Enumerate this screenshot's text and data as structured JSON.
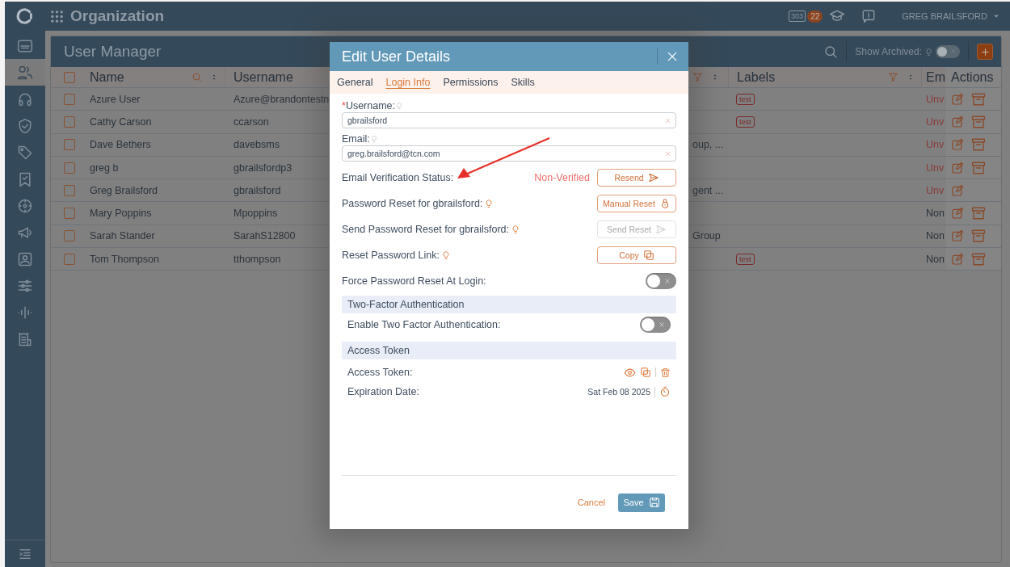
{
  "topbar": {
    "title": "Organization",
    "chat_count": "303",
    "badge": "22",
    "user": "GREG BRAILSFORD"
  },
  "sidebar": {
    "items": [
      {
        "selected": false
      },
      {
        "selected": true
      },
      {
        "selected": false
      },
      {
        "selected": false
      },
      {
        "selected": false
      },
      {
        "selected": false
      },
      {
        "selected": false
      },
      {
        "selected": false
      },
      {
        "selected": false
      },
      {
        "selected": false
      },
      {
        "selected": false
      },
      {
        "selected": false
      }
    ]
  },
  "panel": {
    "title": "User Manager",
    "show_archived": {
      "label": "Show Archived:",
      "on": false
    }
  },
  "table": {
    "select_all": {
      "checked": false
    },
    "columns": [
      {
        "label": "Name"
      },
      {
        "label": "Username"
      },
      {
        "label": "Labels"
      },
      {
        "label": "Em"
      },
      {
        "label": "Actions"
      }
    ],
    "rows": [
      {
        "checked": false,
        "name": "Azure User",
        "username": "Azure@brandontestn",
        "label_tag": "test",
        "email_status": "Unv",
        "color": "#8a3a3a",
        "archivable": true
      },
      {
        "checked": false,
        "name": "Cathy Carson",
        "username": "ccarson",
        "label_tag": "test",
        "email_status": "Unv",
        "color": "#8a3a3a",
        "archivable": true
      },
      {
        "checked": false,
        "name": "Dave Bethers",
        "username": "davebsms",
        "column_4": "oup, ...",
        "email_status": "Unv",
        "color": "#8a3a3a",
        "archivable": true
      },
      {
        "checked": false,
        "name": "greg b",
        "username": "gbrailsfordp3",
        "email_status": "Unv",
        "color": "#8a3a3a",
        "archivable": true
      },
      {
        "checked": false,
        "name": "Greg Brailsford",
        "username": "gbrailsford",
        "column_4": "gent ...",
        "email_status": "Unv",
        "color": "#8a3a3a",
        "archivable": false
      },
      {
        "checked": false,
        "name": "Mary Poppins",
        "username": "Mpoppins",
        "email_status": "Non",
        "color": "#2a323a",
        "archivable": true
      },
      {
        "checked": false,
        "name": "Sarah Stander",
        "username": "SarahS12800",
        "column_4": "Group",
        "email_status": "Non",
        "color": "#2a323a",
        "archivable": true
      },
      {
        "checked": false,
        "name": "Tom Thompson",
        "username": "tthompson",
        "label_tag": "test",
        "email_status": "Non",
        "color": "#2a323a",
        "archivable": true
      }
    ]
  },
  "dialog": {
    "title": "Edit User Details",
    "tabs": [
      {
        "label": "General",
        "selected": false
      },
      {
        "label": "Login Info",
        "selected": true
      },
      {
        "label": "Permissions",
        "selected": false
      },
      {
        "label": "Skills",
        "selected": false
      }
    ],
    "fields": [
      {
        "required_mark": "*",
        "label": "Username:",
        "value": "gbrailsford"
      },
      {
        "label": "Email:",
        "value": "greg.brailsford@tcn.com"
      }
    ],
    "actions": [
      {
        "label": "Email Verification Status:",
        "hint": false,
        "status": "Non-Verified",
        "button": {
          "label": "Resend",
          "disabled": false
        }
      },
      {
        "label": "Password Reset for gbrailsford:",
        "hint": true,
        "button": {
          "label": "Manual Reset",
          "disabled": false
        }
      },
      {
        "label": "Send Password Reset for gbrailsford:",
        "hint": true,
        "button": {
          "label": "Send Reset",
          "disabled": true
        }
      },
      {
        "label": "Reset Password Link:",
        "hint": true,
        "button": {
          "label": "Copy",
          "disabled": false
        }
      }
    ],
    "force_reset": {
      "label": "Force Password Reset At Login:",
      "on": false
    },
    "two_factor": {
      "heading": "Two-Factor Authentication",
      "label": "Enable Two Factor Authentication:",
      "on": false
    },
    "access_token": {
      "heading": "Access Token",
      "token_label": "Access Token:",
      "expiration_label": "Expiration Date:",
      "expiration_date": "Sat Feb 08 2025"
    },
    "footer": {
      "cancel": "Cancel",
      "save": "Save"
    }
  }
}
